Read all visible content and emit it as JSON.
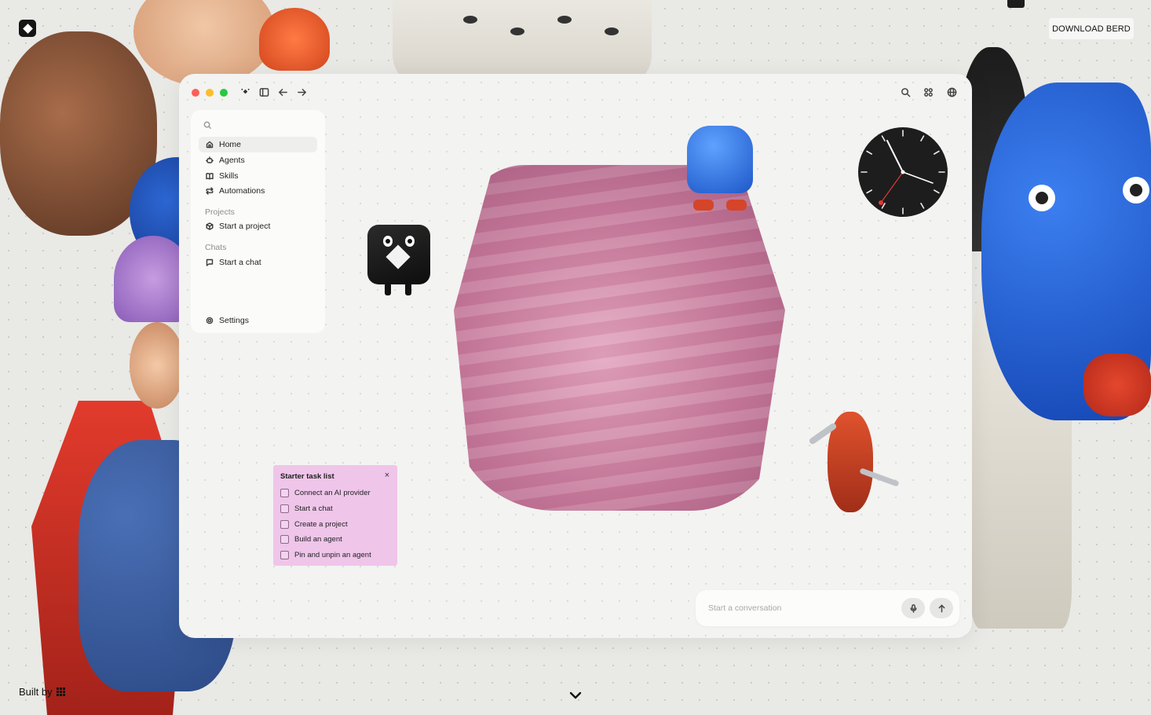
{
  "header": {
    "download_label": "DOWNLOAD BERD"
  },
  "sidebar": {
    "items": [
      {
        "label": "Home",
        "icon": "home-icon",
        "active": true
      },
      {
        "label": "Agents",
        "icon": "agent-icon"
      },
      {
        "label": "Skills",
        "icon": "book-icon"
      },
      {
        "label": "Automations",
        "icon": "repeat-icon"
      }
    ],
    "projects_heading": "Projects",
    "start_project_label": "Start a project",
    "chats_heading": "Chats",
    "start_chat_label": "Start a chat",
    "settings_label": "Settings"
  },
  "tasks": {
    "title": "Starter task list",
    "close": "×",
    "items": [
      "Connect an AI provider",
      "Start a chat",
      "Create a project",
      "Build an agent",
      "Pin and unpin an agent"
    ]
  },
  "composer": {
    "placeholder": "Start a conversation"
  },
  "footer": {
    "built_by": "Built by"
  },
  "colors": {
    "task_list_bg": "#efc5ea",
    "window_bg": "#f3f3f1",
    "clock_face": "#1d1d1d",
    "clock_second_hand": "#e53935"
  }
}
